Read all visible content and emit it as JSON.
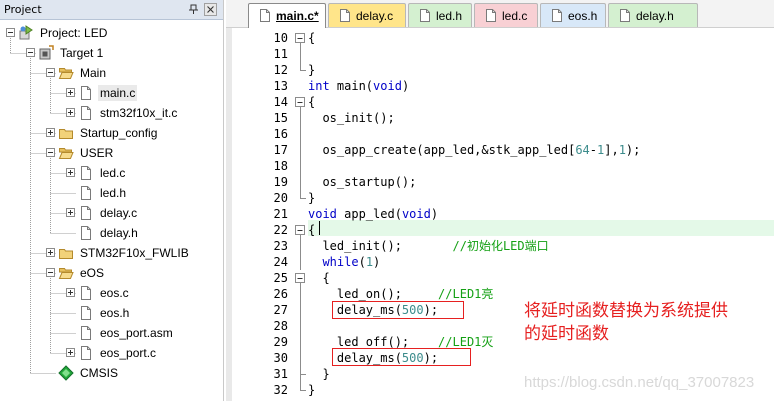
{
  "project_panel": {
    "title": "Project",
    "tree": [
      {
        "label": "Project: LED",
        "level": 0,
        "expander": "minus",
        "icon": "project-icon"
      },
      {
        "label": "Target 1",
        "level": 1,
        "expander": "minus",
        "icon": "target-icon"
      },
      {
        "label": "Main",
        "level": 2,
        "expander": "minus",
        "icon": "folder-open-icon"
      },
      {
        "label": "main.c",
        "level": 3,
        "expander": "plus",
        "icon": "file-icon",
        "selected": true
      },
      {
        "label": "stm32f10x_it.c",
        "level": 3,
        "expander": "plus",
        "icon": "file-icon"
      },
      {
        "label": "Startup_config",
        "level": 2,
        "expander": "plus",
        "icon": "folder-icon"
      },
      {
        "label": "USER",
        "level": 2,
        "expander": "minus",
        "icon": "folder-open-icon"
      },
      {
        "label": "led.c",
        "level": 3,
        "expander": "plus",
        "icon": "file-icon"
      },
      {
        "label": "led.h",
        "level": 3,
        "expander": "none",
        "icon": "file-icon"
      },
      {
        "label": "delay.c",
        "level": 3,
        "expander": "plus",
        "icon": "file-icon"
      },
      {
        "label": "delay.h",
        "level": 3,
        "expander": "none",
        "icon": "file-icon"
      },
      {
        "label": "STM32F10x_FWLIB",
        "level": 2,
        "expander": "plus",
        "icon": "folder-icon"
      },
      {
        "label": "eOS",
        "level": 2,
        "expander": "minus",
        "icon": "folder-open-icon"
      },
      {
        "label": "eos.c",
        "level": 3,
        "expander": "plus",
        "icon": "file-icon"
      },
      {
        "label": "eos.h",
        "level": 3,
        "expander": "none",
        "icon": "file-icon"
      },
      {
        "label": "eos_port.asm",
        "level": 3,
        "expander": "none",
        "icon": "file-icon"
      },
      {
        "label": "eos_port.c",
        "level": 3,
        "expander": "plus",
        "icon": "file-icon"
      },
      {
        "label": "CMSIS",
        "level": 2,
        "expander": "none",
        "icon": "cmsis-icon"
      }
    ]
  },
  "tabs": [
    {
      "label": "main.c*",
      "color": "#ffffff",
      "active": true
    },
    {
      "label": "delay.c",
      "color": "#ffe58a"
    },
    {
      "label": "led.h",
      "color": "#d4f0d0"
    },
    {
      "label": "led.c",
      "color": "#f8d0d4"
    },
    {
      "label": "eos.h",
      "color": "#d8e8f8"
    },
    {
      "label": "delay.h",
      "color": "#d4f0d0"
    }
  ],
  "code_lines": [
    {
      "num": "10",
      "text": "{",
      "fold": "open"
    },
    {
      "num": "11",
      "text": "",
      "fold": "line"
    },
    {
      "num": "12",
      "text": "}",
      "fold": "end"
    },
    {
      "num": "13",
      "text": "int main(void)",
      "fold": "none"
    },
    {
      "num": "14",
      "text": "{",
      "fold": "open"
    },
    {
      "num": "15",
      "text": "  os_init();",
      "fold": "line"
    },
    {
      "num": "16",
      "text": "",
      "fold": "line"
    },
    {
      "num": "17",
      "text": "  os_app_create(app_led,&stk_app_led[64-1],1);",
      "fold": "line"
    },
    {
      "num": "18",
      "text": "",
      "fold": "line"
    },
    {
      "num": "19",
      "text": "  os_startup();",
      "fold": "line"
    },
    {
      "num": "20",
      "text": "}",
      "fold": "end"
    },
    {
      "num": "21",
      "text": "void app_led(void)",
      "fold": "none"
    },
    {
      "num": "22",
      "text": "{",
      "fold": "open"
    },
    {
      "num": "23",
      "text": "  led_init();       //初始化LED端口",
      "fold": "line"
    },
    {
      "num": "24",
      "text": "  while(1)",
      "fold": "line"
    },
    {
      "num": "25",
      "text": "  {",
      "fold": "open"
    },
    {
      "num": "26",
      "text": "    led_on();     //LED1亮",
      "fold": "line"
    },
    {
      "num": "27",
      "text": "    delay_ms(500);",
      "fold": "line"
    },
    {
      "num": "28",
      "text": "",
      "fold": "line"
    },
    {
      "num": "29",
      "text": "    led_off();    //LED1灭",
      "fold": "line"
    },
    {
      "num": "30",
      "text": "    delay_ms(500);",
      "fold": "line"
    },
    {
      "num": "31",
      "text": "  }",
      "fold": "end"
    },
    {
      "num": "32",
      "text": "}",
      "fold": "end"
    }
  ],
  "annotation": {
    "line1": "将延时函数替换为系统提供",
    "line2": "的延时函数"
  },
  "watermark": "https://blog.csdn.net/qq_37007823",
  "colors": {
    "keyword": "#0000c8",
    "number": "#3c8c8c",
    "comment": "#14a014",
    "annotation": "#e62020"
  }
}
